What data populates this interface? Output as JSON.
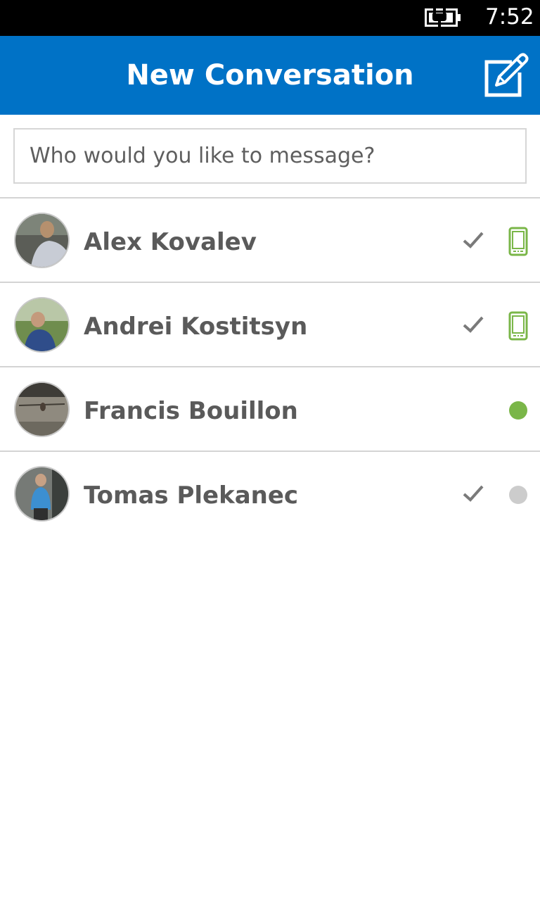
{
  "status_bar": {
    "time": "7:52",
    "battery_icon": "battery-charging-icon"
  },
  "header": {
    "title": "New Conversation",
    "compose_icon": "compose-icon"
  },
  "search": {
    "placeholder": "Who would you like to message?",
    "value": ""
  },
  "colors": {
    "accent": "#0072c6",
    "online": "#7ab648",
    "offline": "#cccccc",
    "text": "#5a5a5a"
  },
  "contacts": [
    {
      "name": "Alex Kovalev",
      "checked": true,
      "status": "mobile"
    },
    {
      "name": "Andrei Kostitsyn",
      "checked": true,
      "status": "mobile"
    },
    {
      "name": "Francis Bouillon",
      "checked": false,
      "status": "online"
    },
    {
      "name": "Tomas Plekanec",
      "checked": true,
      "status": "offline"
    }
  ]
}
